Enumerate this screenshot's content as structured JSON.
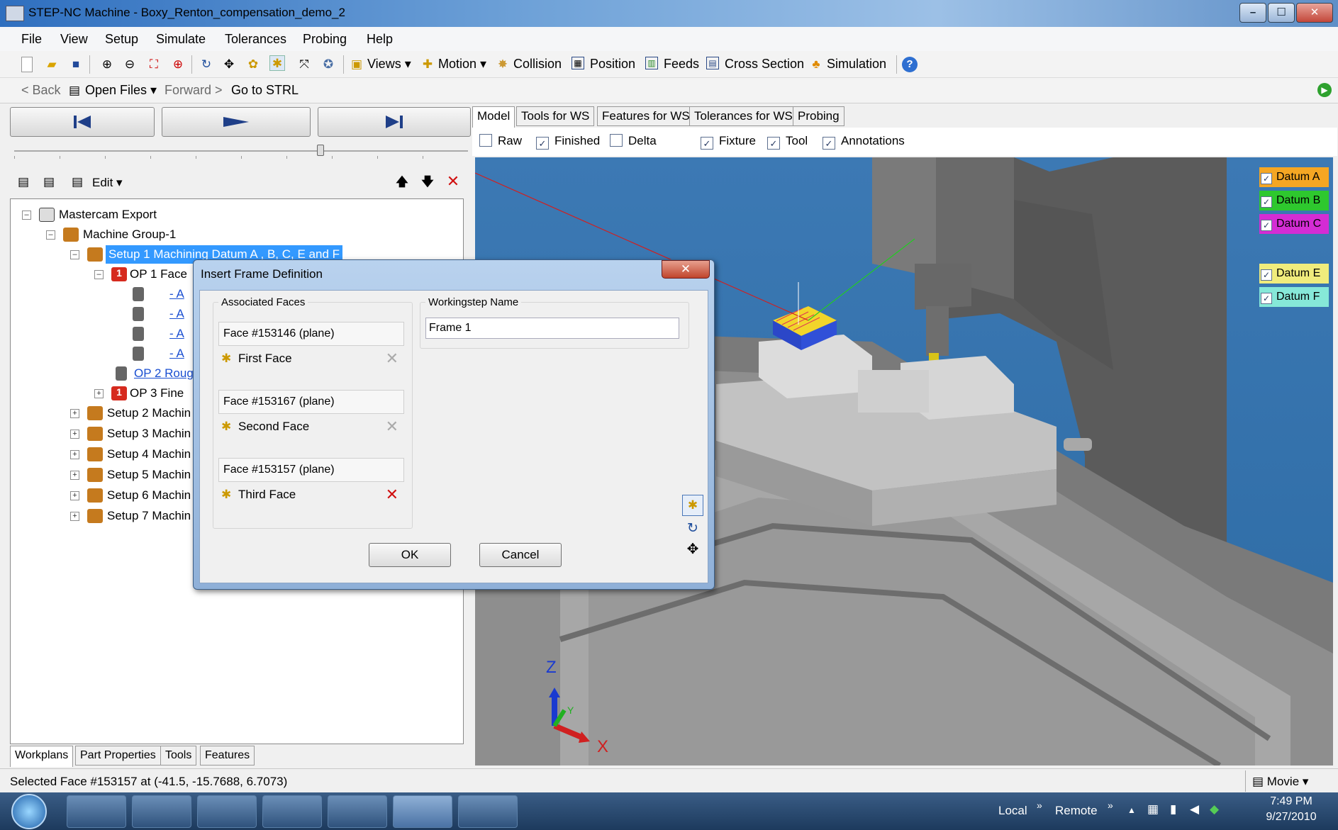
{
  "window": {
    "title": "STEP-NC Machine - Boxy_Renton_compensation_demo_2",
    "min": "–",
    "max": "☐",
    "close": "✕"
  },
  "menu": [
    "File",
    "View",
    "Setup",
    "Simulate",
    "Tolerances",
    "Probing",
    "Help"
  ],
  "toolbar": {
    "views": "Views",
    "motion": "Motion",
    "collision": "Collision",
    "position": "Position",
    "feeds": "Feeds",
    "cross_section": "Cross Section",
    "simulation": "Simulation"
  },
  "nav": {
    "back": "< Back",
    "open_files": "Open Files",
    "forward": "Forward >",
    "go_to_strl": "Go to STRL"
  },
  "tree_toolbar": {
    "edit": "Edit"
  },
  "tree": [
    {
      "label": "Mastercam Export"
    },
    {
      "label": "Machine Group-1"
    },
    {
      "label": "Setup 1 Machining Datum A , B, C, E and F"
    },
    {
      "label": "OP 1 Face"
    },
    {
      "label": "- A"
    },
    {
      "label": "- A"
    },
    {
      "label": "- A"
    },
    {
      "label": "- A"
    },
    {
      "label": "OP 2 Roug"
    },
    {
      "label": "OP 3 Fine"
    },
    {
      "label": "Setup 2 Machin"
    },
    {
      "label": "Setup 3 Machin"
    },
    {
      "label": "Setup 4 Machin"
    },
    {
      "label": "Setup 5 Machin"
    },
    {
      "label": "Setup 6 Machin"
    },
    {
      "label": "Setup 7 Machin"
    }
  ],
  "bottom_tabs": [
    "Workplans",
    "Part Properties",
    "Tools",
    "Features"
  ],
  "view_tabs": [
    "Model",
    "Tools for WS",
    "Features for WS",
    "Tolerances for WS",
    "Probing"
  ],
  "view_checks": [
    {
      "label": "Raw",
      "checked": false
    },
    {
      "label": "Finished",
      "checked": true
    },
    {
      "label": "Delta",
      "checked": false
    },
    {
      "label": "Fixture",
      "checked": true
    },
    {
      "label": "Tool",
      "checked": true
    },
    {
      "label": "Annotations",
      "checked": true
    }
  ],
  "datums": [
    {
      "label": "Datum A",
      "color": "#f5a623"
    },
    {
      "label": "Datum B",
      "color": "#2ec82e"
    },
    {
      "label": "Datum C",
      "color": "#d42cd4"
    },
    {
      "label": "Datum E",
      "color": "#f0ec7c"
    },
    {
      "label": "Datum F",
      "color": "#86e8d8"
    }
  ],
  "axes": {
    "x": "X",
    "y": "Y",
    "z": "Z"
  },
  "dialog": {
    "title": "Insert Frame Definition",
    "assoc_label": "Associated Faces",
    "ws_label": "Workingstep Name",
    "ws_value": "Frame 1",
    "faces": [
      {
        "header": "Face #153146 (plane)",
        "name": "First Face"
      },
      {
        "header": "Face #153167 (plane)",
        "name": "Second Face"
      },
      {
        "header": "Face #153157 (plane)",
        "name": "Third Face"
      }
    ],
    "ok": "OK",
    "cancel": "Cancel"
  },
  "status": {
    "text": "Selected Face #153157 at (-41.5, -15.7688, 6.7073)",
    "movie": "Movie"
  },
  "taskbar": {
    "local": "Local",
    "remote": "Remote",
    "time": "7:49 PM",
    "date": "9/27/2010"
  }
}
